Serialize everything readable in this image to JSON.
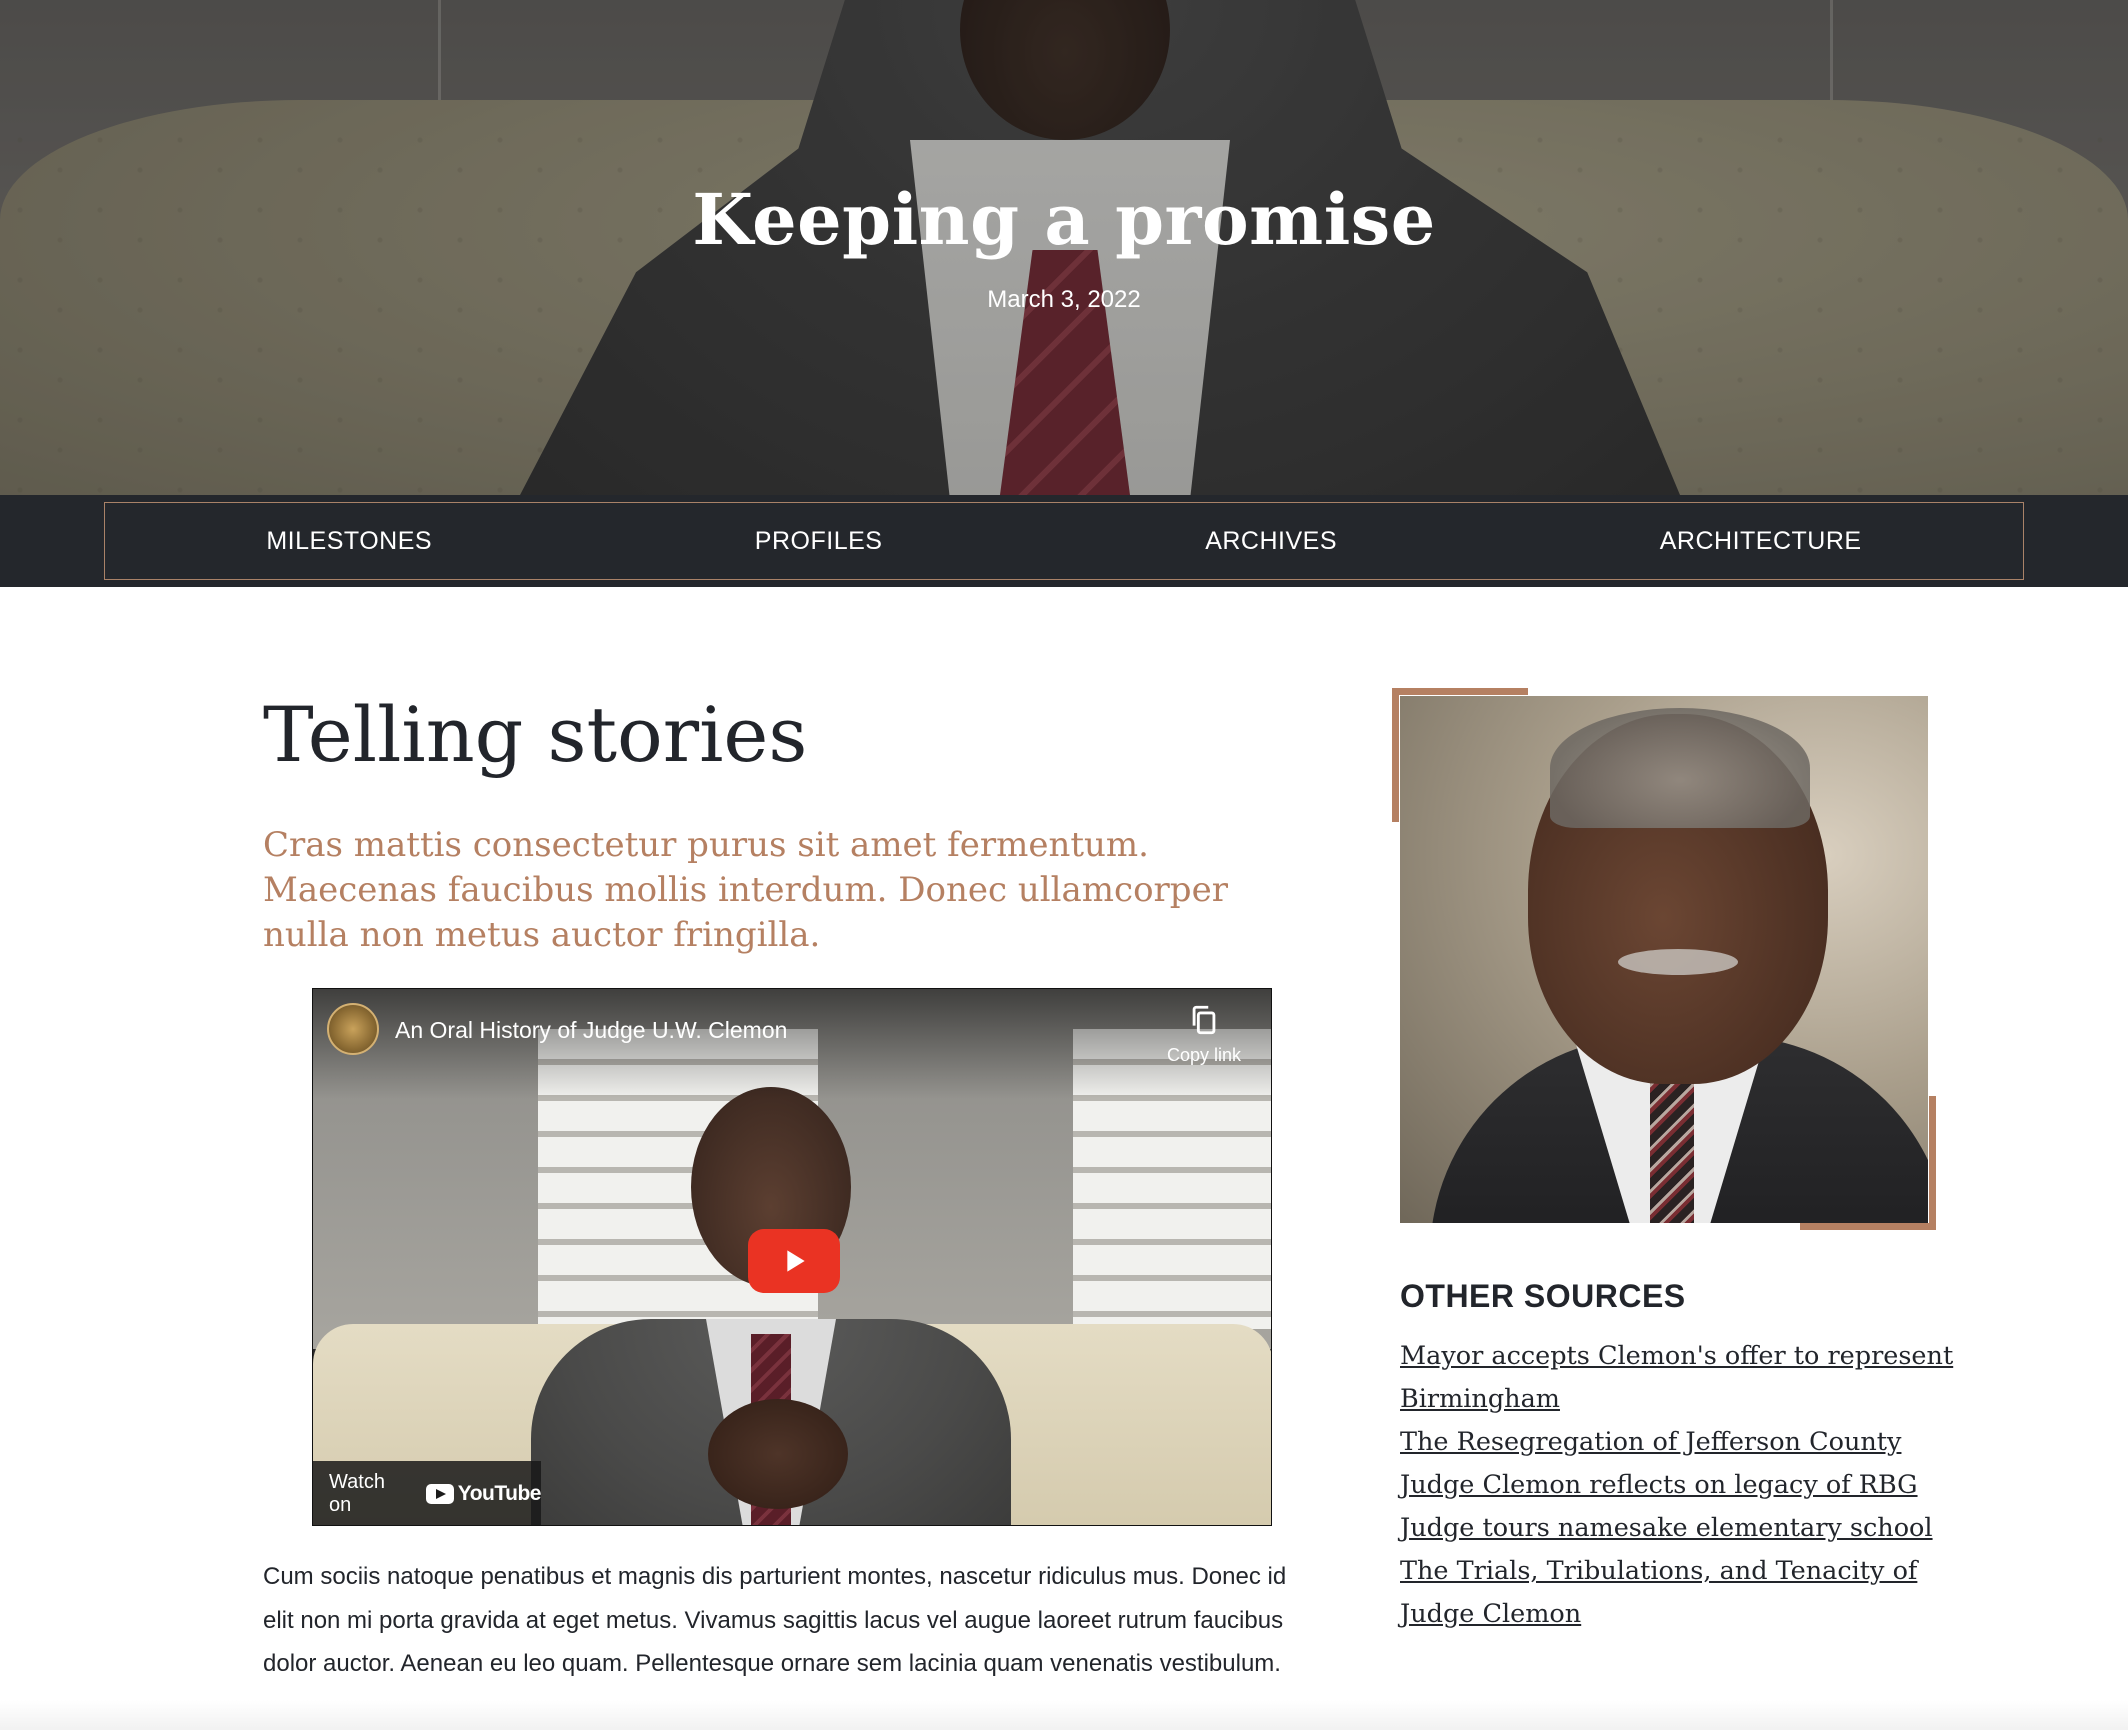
{
  "hero": {
    "title": "Keeping a promise",
    "date": "March 3, 2022"
  },
  "nav": {
    "items": [
      {
        "label": "MILESTONES"
      },
      {
        "label": "PROFILES"
      },
      {
        "label": "ARCHIVES"
      },
      {
        "label": "ARCHITECTURE"
      }
    ]
  },
  "main": {
    "heading": "Telling stories",
    "lead": "Cras mattis consectetur purus sit amet fermentum. Maecenas faucibus mollis interdum. Donec ullamcorper nulla non metus auctor fringilla.",
    "video": {
      "title": "An Oral History of Judge U.W. Clemon",
      "copy_link_label": "Copy link",
      "watch_on_label": "Watch on",
      "youtube_label": "YouTube"
    },
    "body": "Cum sociis natoque penatibus et magnis dis parturient montes, nascetur ridiculus mus. Donec id elit non mi porta gravida at eget metus. Vivamus sagittis lacus vel augue laoreet rutrum faucibus dolor auctor. Aenean eu leo quam. Pellentesque ornare sem lacinia quam venenatis vestibulum."
  },
  "sidebar": {
    "sources_title": "OTHER SOURCES",
    "sources": [
      {
        "label": "Mayor accepts Clemon's offer to represent Birmingham"
      },
      {
        "label": "The Resegregation of Jefferson County"
      },
      {
        "label": "Judge Clemon reflects on legacy of RBG"
      },
      {
        "label": "Judge tours namesake elementary school"
      },
      {
        "label": "The Trials, Tribulations, and Tenacity of Judge Clemon"
      }
    ]
  },
  "colors": {
    "accent": "#b58062",
    "nav_bg": "#24272c",
    "text": "#22252b",
    "play_button": "#ea3323"
  },
  "icons": {
    "copy_link": "copy-icon",
    "play": "play-icon",
    "youtube": "youtube-logo-icon",
    "channel": "court-seal-icon"
  }
}
